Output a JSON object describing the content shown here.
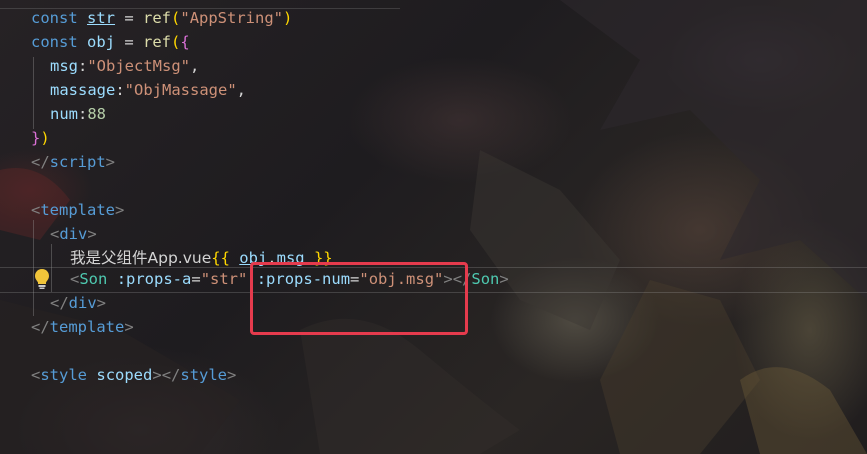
{
  "code": {
    "l1": {
      "kw": "const",
      "var": "str",
      "op": " = ",
      "fn": "ref",
      "p1": "(",
      "s": "\"AppString\"",
      "p2": ")"
    },
    "l2": {
      "kw": "const",
      "var": "obj",
      "op": " = ",
      "fn": "ref",
      "p1": "(",
      "b": "{"
    },
    "l3": {
      "key": "msg",
      "colon": ":",
      "val": "\"ObjectMsg\"",
      "comma": ","
    },
    "l4": {
      "key": "massage",
      "colon": ":",
      "val": "\"ObjMassage\"",
      "comma": ","
    },
    "l5": {
      "key": "num",
      "colon": ":",
      "val": "88"
    },
    "l6": {
      "b": "}",
      "p": ")"
    },
    "l7": {
      "open": "</",
      "tag": "script",
      "close": ">"
    },
    "l9": {
      "open": "<",
      "tag": "template",
      "close": ">"
    },
    "l10": {
      "open": "<",
      "tag": "div",
      "close": ">"
    },
    "l11": {
      "text": "我是父组件App.vue",
      "m1": "{{",
      "expr_obj": "obj",
      "expr_dot": ".",
      "expr_msg": "msg",
      "m2": "}}"
    },
    "l12": {
      "open": "<",
      "comp": "Son",
      "attr1": ":props-a",
      "eq1": "=",
      "v1": "\"str\"",
      "attr2": ":props-num",
      "eq2": "=",
      "v2": "\"obj.msg\"",
      "mid": "></",
      "comp2": "Son",
      "close": ">"
    },
    "l13": {
      "open": "</",
      "tag": "div",
      "close": ">"
    },
    "l14": {
      "open": "</",
      "tag": "template",
      "close": ">"
    },
    "l16": {
      "open": "<",
      "tag": "style",
      "attr": "scoped",
      "mid": "></",
      "tag2": "style",
      "close": ">"
    }
  },
  "icons": {
    "bulb": "lightbulb-icon"
  },
  "colors": {
    "highlight": "#e53b4d",
    "bulb": "#f0c43a"
  }
}
